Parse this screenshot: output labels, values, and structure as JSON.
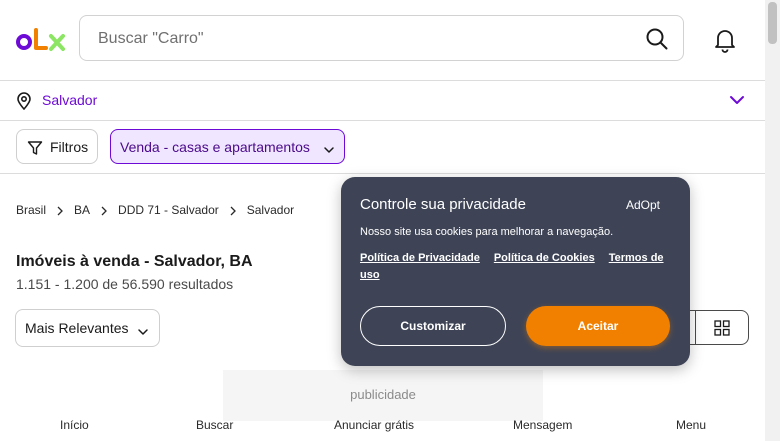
{
  "brand": {
    "logo_text": "olx",
    "colors": {
      "purple": "#6d0ad6",
      "orange": "#f28000",
      "green": "#8ce563"
    }
  },
  "search": {
    "placeholder": "Buscar \"Carro\"",
    "icon": "search-icon"
  },
  "header": {
    "notification_icon": "bell-icon"
  },
  "location": {
    "label": "Salvador",
    "icon": "map-pin-icon"
  },
  "filters": {
    "filter_button": "Filtros",
    "category_chip": "Venda - casas e apartamentos"
  },
  "breadcrumb": [
    "Brasil",
    "BA",
    "DDD 71 - Salvador",
    "Salvador"
  ],
  "listing": {
    "title": "Imóveis à venda - Salvador, BA",
    "results": "1.151 - 1.200 de 56.590 resultados",
    "sort": "Mais Relevantes"
  },
  "ad": {
    "label": "publicidade"
  },
  "bottom_nav": [
    "Início",
    "Buscar",
    "Anunciar grátis",
    "Mensagem",
    "Menu"
  ],
  "privacy": {
    "title": "Controle sua privacidade",
    "brand": "AdOpt",
    "text": "Nosso site usa cookies para melhorar a navegação.",
    "links": [
      "Política de Privacidade",
      "Política de Cookies",
      "Termos de uso"
    ],
    "customize": "Customizar",
    "accept": "Aceitar"
  }
}
